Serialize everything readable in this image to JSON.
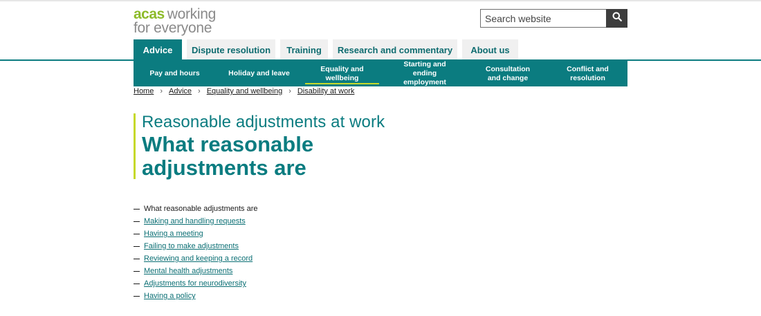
{
  "logo": {
    "brand": "acas",
    "tagline_line1": "working",
    "tagline_line2": "for everyone"
  },
  "search": {
    "placeholder": "Search website",
    "icon": "search-icon"
  },
  "main_nav": [
    {
      "label": "Advice",
      "active": true
    },
    {
      "label": "Dispute resolution",
      "active": false
    },
    {
      "label": "Training",
      "active": false
    },
    {
      "label": "Research and commentary",
      "active": false
    },
    {
      "label": "About us",
      "active": false
    }
  ],
  "sub_nav": [
    {
      "label": "Pay and hours"
    },
    {
      "label": "Holiday and leave"
    },
    {
      "label": "Equality and wellbeing",
      "active": true
    },
    {
      "label": "Starting and ending employment"
    },
    {
      "label": "Consultation and change"
    },
    {
      "label": "Conflict and resolution"
    }
  ],
  "breadcrumb": [
    "Home",
    "Advice",
    "Equality and wellbeing",
    "Disability at work"
  ],
  "heading": {
    "guide_title": "Reasonable adjustments at work",
    "page_title": "What reasonable adjustments are"
  },
  "contents": [
    {
      "label": "What reasonable adjustments are",
      "current": true
    },
    {
      "label": "Making and handling requests"
    },
    {
      "label": "Having a meeting"
    },
    {
      "label": "Failing to make adjustments"
    },
    {
      "label": "Reviewing and keeping a record"
    },
    {
      "label": "Mental health adjustments"
    },
    {
      "label": "Adjustments for neurodiversity"
    },
    {
      "label": "Having a policy"
    }
  ],
  "colors": {
    "teal": "#0b7c80",
    "lime": "#c6d92a",
    "logo_green": "#8dbb2a"
  }
}
